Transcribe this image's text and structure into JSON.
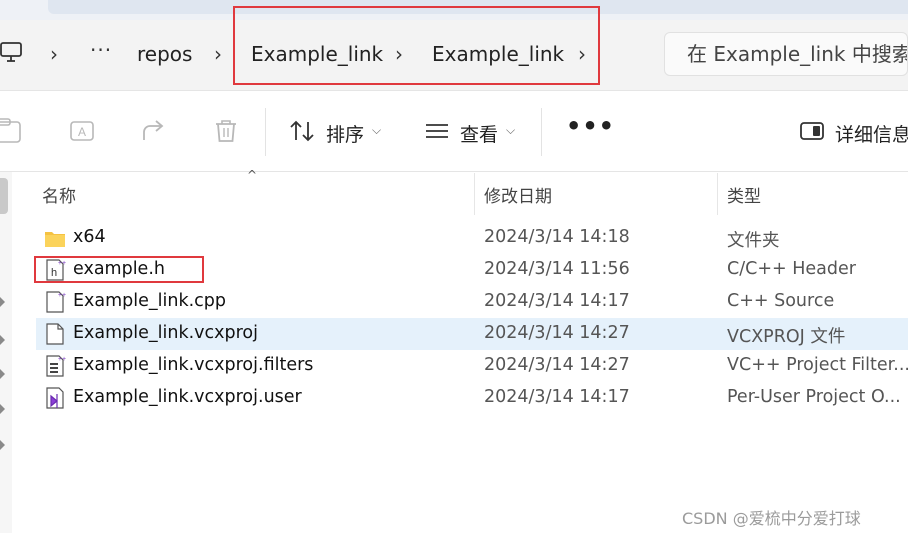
{
  "address": {
    "overflow": "···",
    "crumbs": [
      "repos",
      "Example_link",
      "Example_link"
    ]
  },
  "search": {
    "placeholder": "在 Example_link 中搜索"
  },
  "toolbar": {
    "sort_label": "排序",
    "view_label": "查看",
    "details_label": "详细信息"
  },
  "columns": {
    "name": "名称",
    "modified": "修改日期",
    "type": "类型"
  },
  "files": [
    {
      "name": "x64",
      "modified": "2024/3/14 14:18",
      "type": "文件夹",
      "icon": "folder-icon"
    },
    {
      "name": "example.h",
      "modified": "2024/3/14 11:56",
      "type": "C/C++ Header",
      "icon": "header-file-icon"
    },
    {
      "name": "Example_link.cpp",
      "modified": "2024/3/14 14:17",
      "type": "C++ Source",
      "icon": "cpp-file-icon"
    },
    {
      "name": "Example_link.vcxproj",
      "modified": "2024/3/14 14:27",
      "type": "VCXPROJ 文件",
      "icon": "blank-file-icon"
    },
    {
      "name": "Example_link.vcxproj.filters",
      "modified": "2024/3/14 14:27",
      "type": "VC++ Project Filter...",
      "icon": "filters-file-icon"
    },
    {
      "name": "Example_link.vcxproj.user",
      "modified": "2024/3/14 14:17",
      "type": "Per-User Project O...",
      "icon": "visual-studio-file-icon"
    }
  ],
  "watermark": "CSDN @爱梳中分爱打球",
  "colors": {
    "highlight_box": "#e0393e",
    "selected_row": "#e5f1fb",
    "folder": "#f5c242"
  }
}
